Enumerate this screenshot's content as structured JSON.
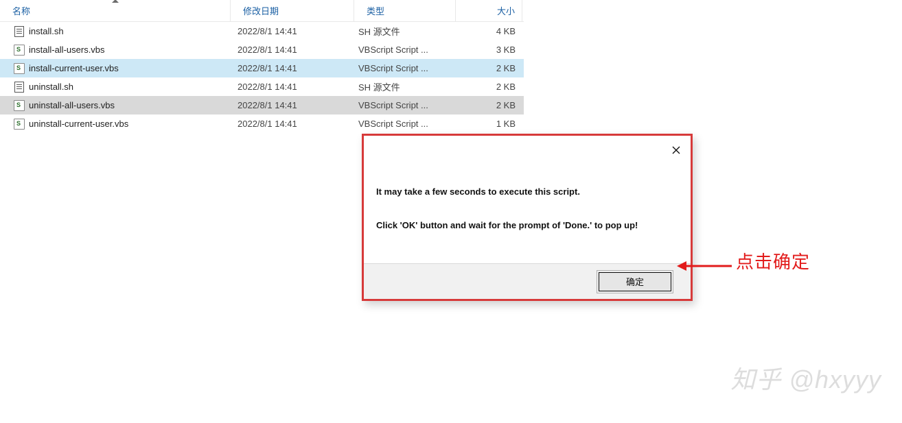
{
  "columns": {
    "name": "名称",
    "date": "修改日期",
    "type": "类型",
    "size": "大小"
  },
  "files": [
    {
      "name": "install.sh",
      "date": "2022/8/1 14:41",
      "type": "SH 源文件",
      "size": "4 KB",
      "icon": "sh",
      "state": ""
    },
    {
      "name": "install-all-users.vbs",
      "date": "2022/8/1 14:41",
      "type": "VBScript Script ...",
      "size": "3 KB",
      "icon": "vbs",
      "state": ""
    },
    {
      "name": "install-current-user.vbs",
      "date": "2022/8/1 14:41",
      "type": "VBScript Script ...",
      "size": "2 KB",
      "icon": "vbs",
      "state": "selected"
    },
    {
      "name": "uninstall.sh",
      "date": "2022/8/1 14:41",
      "type": "SH 源文件",
      "size": "2 KB",
      "icon": "sh",
      "state": ""
    },
    {
      "name": "uninstall-all-users.vbs",
      "date": "2022/8/1 14:41",
      "type": "VBScript Script ...",
      "size": "2 KB",
      "icon": "vbs",
      "state": "focused"
    },
    {
      "name": "uninstall-current-user.vbs",
      "date": "2022/8/1 14:41",
      "type": "VBScript Script ...",
      "size": "1 KB",
      "icon": "vbs",
      "state": ""
    }
  ],
  "dialog": {
    "line1": "It may take a few seconds to execute this script.",
    "line2": "Click 'OK' button and wait for the prompt of 'Done.' to pop up!",
    "ok_label": "确定"
  },
  "annotation": {
    "text": "点击确定"
  },
  "watermark": {
    "text": "知乎 @hxyyy"
  }
}
